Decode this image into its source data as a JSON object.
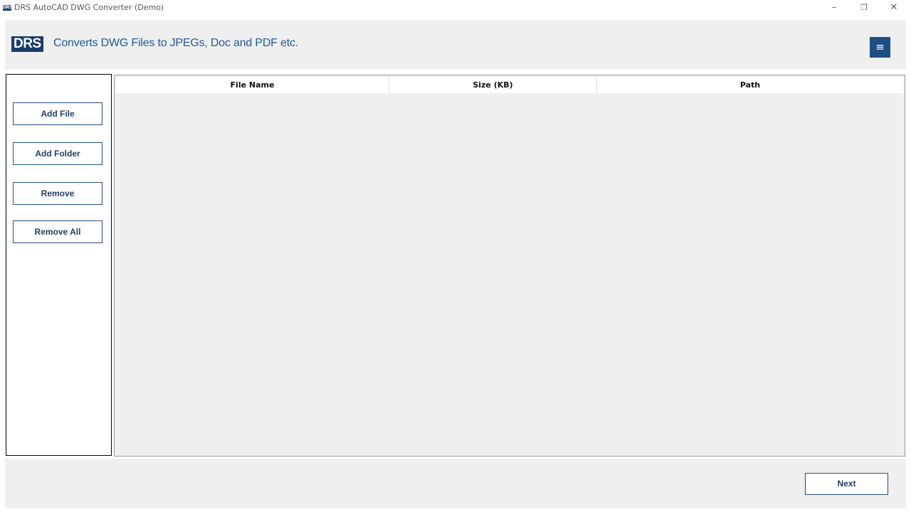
{
  "window": {
    "title": "DRS AutoCAD DWG Converter (Demo)",
    "icon_text": "DRS",
    "controls": {
      "minimize": "–",
      "restore": "❐",
      "close": "✕"
    }
  },
  "header": {
    "logo": "DRS",
    "tagline": "Converts DWG Files to JPEGs, Doc and PDF etc.",
    "menu_icon": "≡"
  },
  "sidebar": {
    "buttons": [
      {
        "label": "Add File"
      },
      {
        "label": "Add Folder"
      },
      {
        "label": "Remove"
      },
      {
        "label": "Remove All"
      }
    ]
  },
  "table": {
    "columns": [
      "File Name",
      "Size (KB)",
      "Path"
    ],
    "rows": []
  },
  "footer": {
    "next_label": "Next"
  }
}
